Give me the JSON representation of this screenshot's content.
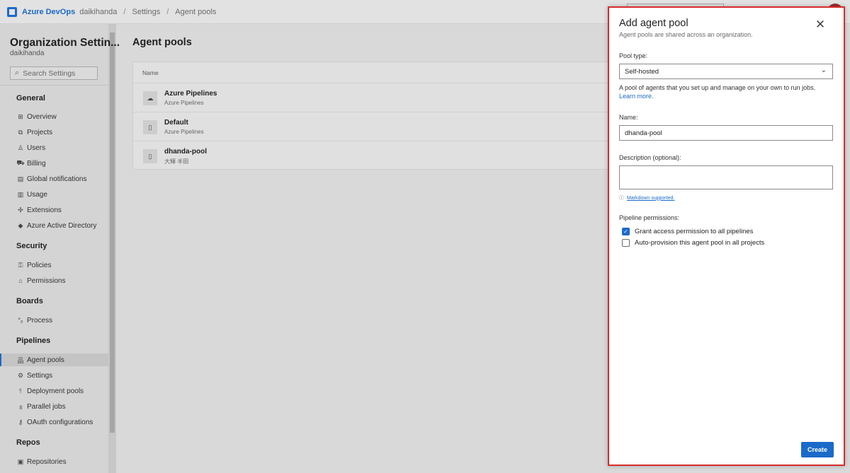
{
  "topbar": {
    "brand": "Azure DevOps",
    "org": "daikihanda",
    "crumbs": [
      "Settings",
      "Agent pools"
    ]
  },
  "sidebar": {
    "title": "Organization Settin...",
    "subtitle": "daikihanda",
    "search_placeholder": "Search Settings",
    "sections": [
      {
        "title": "General",
        "items": [
          {
            "label": "Overview",
            "icon": "overview-icon"
          },
          {
            "label": "Projects",
            "icon": "projects-icon"
          },
          {
            "label": "Users",
            "icon": "users-icon"
          },
          {
            "label": "Billing",
            "icon": "billing-icon"
          },
          {
            "label": "Global notifications",
            "icon": "notifications-icon"
          },
          {
            "label": "Usage",
            "icon": "usage-icon"
          },
          {
            "label": "Extensions",
            "icon": "extensions-icon"
          },
          {
            "label": "Azure Active Directory",
            "icon": "aad-icon"
          }
        ]
      },
      {
        "title": "Security",
        "items": [
          {
            "label": "Policies",
            "icon": "policies-icon"
          },
          {
            "label": "Permissions",
            "icon": "lock-icon"
          }
        ]
      },
      {
        "title": "Boards",
        "items": [
          {
            "label": "Process",
            "icon": "process-icon"
          }
        ]
      },
      {
        "title": "Pipelines",
        "items": [
          {
            "label": "Agent pools",
            "icon": "agent-pools-icon",
            "active": true
          },
          {
            "label": "Settings",
            "icon": "gear-icon"
          },
          {
            "label": "Deployment pools",
            "icon": "deployment-icon"
          },
          {
            "label": "Parallel jobs",
            "icon": "parallel-icon"
          },
          {
            "label": "OAuth configurations",
            "icon": "oauth-icon"
          }
        ]
      },
      {
        "title": "Repos",
        "items": [
          {
            "label": "Repositories",
            "icon": "repo-icon"
          }
        ]
      }
    ]
  },
  "main": {
    "title": "Agent pools",
    "column_header": "Name",
    "rows": [
      {
        "name": "Azure Pipelines",
        "sub": "Azure Pipelines",
        "icon": "cloud-icon"
      },
      {
        "name": "Default",
        "sub": "Azure Pipelines",
        "icon": "server-icon"
      },
      {
        "name": "dhanda-pool",
        "sub": "大輝 半田",
        "icon": "server-icon"
      }
    ]
  },
  "panel": {
    "title": "Add agent pool",
    "subtitle": "Agent pools are shared across an organization.",
    "pool_type_label": "Pool type:",
    "pool_type_value": "Self-hosted",
    "help_text": "A pool of agents that you set up and manage on your own to run jobs.",
    "learn_more": "Learn more.",
    "name_label": "Name:",
    "name_value": "dhanda-pool",
    "description_label": "Description (optional):",
    "description_value": "",
    "markdown_text": "Markdown supported.",
    "permissions_label": "Pipeline permissions:",
    "checkbox_grant": {
      "label": "Grant access permission to all pipelines",
      "checked": true
    },
    "checkbox_auto": {
      "label": "Auto-provision this agent pool in all projects",
      "checked": false
    },
    "create_label": "Create"
  },
  "colors": {
    "accent": "#1b6ac9",
    "highlight_border": "#d62d2d"
  }
}
